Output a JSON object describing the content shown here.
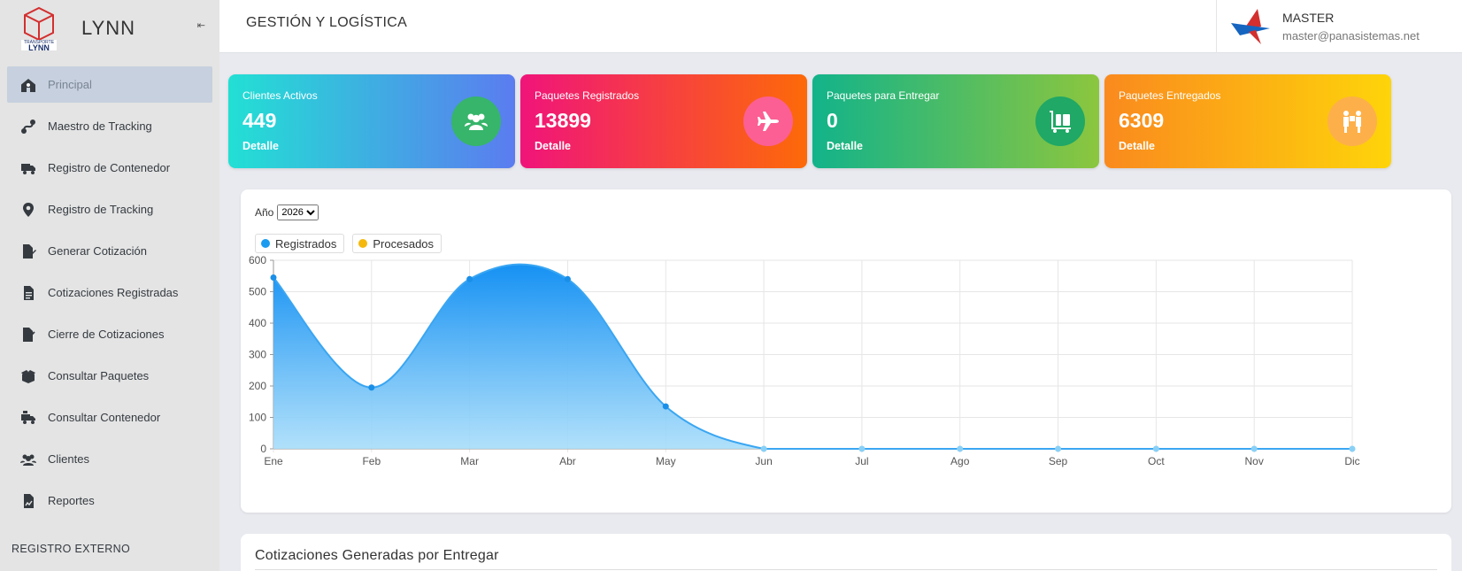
{
  "app": {
    "name": "LYNN",
    "logo_text": "TRANSPORTE LYNN"
  },
  "sidebar": {
    "items": [
      {
        "label": "Principal",
        "icon": "home-icon",
        "active": true
      },
      {
        "label": "Maestro de Tracking",
        "icon": "route-icon"
      },
      {
        "label": "Registro de Contenedor",
        "icon": "truck-icon"
      },
      {
        "label": "Registro de Tracking",
        "icon": "map-marker-icon"
      },
      {
        "label": "Generar Cotización",
        "icon": "file-signature-icon"
      },
      {
        "label": "Cotizaciones Registradas",
        "icon": "file-alt-icon"
      },
      {
        "label": "Cierre de Cotizaciones",
        "icon": "file-contract-icon"
      },
      {
        "label": "Consultar Paquetes",
        "icon": "box-open-icon"
      },
      {
        "label": "Consultar Contenedor",
        "icon": "truck-loading-icon"
      },
      {
        "label": "Clientes",
        "icon": "users-icon"
      },
      {
        "label": "Reportes",
        "icon": "file-chart-icon"
      }
    ],
    "section_label": "REGISTRO EXTERNO"
  },
  "header": {
    "title": "GESTIÓN Y LOGÍSTICA",
    "user": {
      "name": "MASTER",
      "email": "master@panasistemas.net"
    }
  },
  "cards": [
    {
      "label": "Clientes Activos",
      "value": "449",
      "link": "Detalle",
      "icon": "users-icon",
      "colors": [
        "#22e0d4",
        "#5b7cf0"
      ],
      "circle": "#36b56b"
    },
    {
      "label": "Paquetes Registrados",
      "value": "13899",
      "link": "Detalle",
      "icon": "plane-icon",
      "colors": [
        "#f0147a",
        "#fd6a08"
      ],
      "circle": "#fb5f93"
    },
    {
      "label": "Paquetes para Entregar",
      "value": "0",
      "link": "Detalle",
      "icon": "luggage-cart-icon",
      "colors": [
        "#12b38a",
        "#8cc63e"
      ],
      "circle": "#1fa866"
    },
    {
      "label": "Paquetes Entregados",
      "value": "6309",
      "link": "Detalle",
      "icon": "people-carry-icon",
      "colors": [
        "#fa8a1e",
        "#fed40a"
      ],
      "circle": "#fdb04a"
    }
  ],
  "chart_filter": {
    "label": "Año",
    "selected": "2026"
  },
  "chart_data": {
    "type": "area",
    "x": [
      "Ene",
      "Feb",
      "Mar",
      "Abr",
      "May",
      "Jun",
      "Jul",
      "Ago",
      "Sep",
      "Oct",
      "Nov",
      "Dic"
    ],
    "series": [
      {
        "name": "Registrados",
        "color": "#1a9bf0",
        "values": [
          545,
          195,
          540,
          540,
          135,
          0,
          0,
          0,
          0,
          0,
          0,
          0
        ]
      },
      {
        "name": "Procesados",
        "color": "#f5b90e",
        "values": []
      }
    ],
    "ylim": [
      0,
      600
    ],
    "yticks": [
      0,
      100,
      200,
      300,
      400,
      500,
      600
    ],
    "grid": true,
    "legend_position": "top-left"
  },
  "bottom_panel": {
    "title": "Cotizaciones Generadas por Entregar"
  }
}
